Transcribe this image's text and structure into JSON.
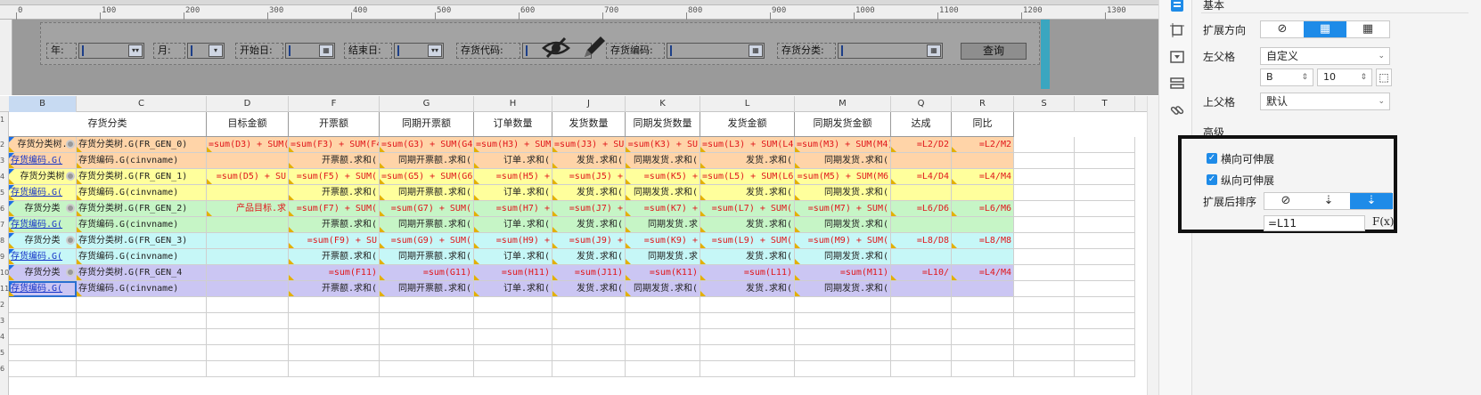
{
  "ruler": {
    "ticks": [
      "0",
      "100",
      "200",
      "300",
      "400",
      "500",
      "600",
      "700",
      "800",
      "900",
      "1000",
      "1100",
      "1200",
      "1300"
    ]
  },
  "params": {
    "year_label": "年:",
    "month_label": "月:",
    "start_label": "开始日:",
    "end_label": "结束日:",
    "stock_code_label": "存货代码:",
    "stock_no_label": "存货编码:",
    "stock_cat_label": "存货分类:",
    "query_button": "查询"
  },
  "sheet": {
    "columns": [
      "B",
      "C",
      "D",
      "F",
      "G",
      "H",
      "J",
      "K",
      "L",
      "M",
      "Q",
      "R",
      "S",
      "T"
    ],
    "selected_column": "B",
    "rows": [
      "1",
      "2",
      "3",
      "4",
      "5",
      "6",
      "7",
      "8",
      "9",
      "10",
      "11",
      "2",
      "3",
      "4",
      "5",
      "6"
    ],
    "header": [
      "存货分类",
      "目标金额",
      "开票额",
      "同期开票额",
      "订单数量",
      "发货数量",
      "同期发货数量",
      "发货金额",
      "同期发货金额",
      "达成",
      "同比"
    ],
    "data_rows": [
      [
        "存货分类树.",
        "存货分类树.G(FR_GEN_0)",
        "=sum(D3) + SUM(",
        "=sum(F3) + SUM(F4",
        "=sum(G3) + SUM(G4)",
        "=sum(H3) + SUM(",
        "=sum(J3) + SU",
        "=sum(K3) + SU",
        "=sum(L3) + SUM(L4)",
        "=sum(M3) + SUM(M4)",
        "=L2/D2",
        "=L2/M2"
      ],
      [
        "存货编码.G(",
        "存货编码.G(cinvname)",
        "",
        "开票额.求和(",
        "同期开票额.求和(",
        "订单.求和(",
        "发货.求和(",
        "同期发货.求和(",
        "发货.求和(",
        "同期发货.求和(",
        "",
        ""
      ],
      [
        "存货分类树",
        "存货分类树.G(FR_GEN_1)",
        "=sum(D5) + SU",
        "=sum(F5) + SUM(",
        "=sum(G5) + SUM(G6",
        "=sum(H5) +",
        "=sum(J5) +",
        "=sum(K5) +",
        "=sum(L5) + SUM(L6",
        "=sum(M5) + SUM(M6",
        "=L4/D4",
        "=L4/M4"
      ],
      [
        "存货编码.G(",
        "存货编码.G(cinvname)",
        "",
        "开票额.求和(",
        "同期开票额.求和(",
        "订单.求和(",
        "发货.求和(",
        "同期发货.求和(",
        "发货.求和(",
        "同期发货.求和(",
        "",
        ""
      ],
      [
        "存货分类",
        "存货分类树.G(FR_GEN_2)",
        "产品目标.求",
        "=sum(F7) + SUM(",
        "=sum(G7) + SUM(",
        "=sum(H7) +",
        "=sum(J7) +",
        "=sum(K7) +",
        "=sum(L7) + SUM(",
        "=sum(M7) + SUM(",
        "=L6/D6",
        "=L6/M6"
      ],
      [
        "存货编码.G(",
        "存货编码.G(cinvname)",
        "",
        "开票额.求和(",
        "同期开票额.求和(",
        "订单.求和(",
        "发货.求和(",
        "同期发货.求",
        "发货.求和(",
        "同期发货.求和(",
        "",
        ""
      ],
      [
        "存货分类",
        "存货分类树.G(FR_GEN_3)",
        "",
        "=sum(F9) + SU",
        "=sum(G9) + SUM(",
        "=sum(H9) +",
        "=sum(J9) +",
        "=sum(K9) +",
        "=sum(L9) + SUM(",
        "=sum(M9) + SUM(",
        "=L8/D8",
        "=L8/M8"
      ],
      [
        "存货编码.G(",
        "存货编码.G(cinvname)",
        "",
        "开票额.求和(",
        "同期开票额.求和(",
        "订单.求和(",
        "发货.求和(",
        "同期发货.求",
        "发货.求和(",
        "同期发货.求和(",
        "",
        ""
      ],
      [
        "存货分类",
        "存货分类树.G(FR_GEN_4",
        "",
        "=sum(F11)",
        "=sum(G11)",
        "=sum(H11)",
        "=sum(J11)",
        "=sum(K11)",
        "=sum(L11)",
        "=sum(M11)",
        "=L10/",
        "=L4/M4"
      ],
      [
        "存货编码.G(",
        "存货编码.G(cinvname)",
        "",
        "开票额.求和(",
        "同期开票额.求和(",
        "订单.求和(",
        "发货.求和(",
        "同期发货.求和(",
        "发货.求和(",
        "同期发货.求和(",
        "",
        ""
      ]
    ]
  },
  "panel": {
    "section_basic": "基本",
    "expand_direction_label": "扩展方向",
    "left_parent_label": "左父格",
    "left_parent_mode": "自定义",
    "left_parent_col": "B",
    "left_parent_row": "10",
    "top_parent_label": "上父格",
    "top_parent_mode": "默认",
    "section_advanced": "高级",
    "horizontal_expandable": "横向可伸展",
    "vertical_expandable": "纵向可伸展",
    "sort_after_expand_label": "扩展后排序",
    "sort_formula": "=L11",
    "fx_label": "F(x)"
  }
}
